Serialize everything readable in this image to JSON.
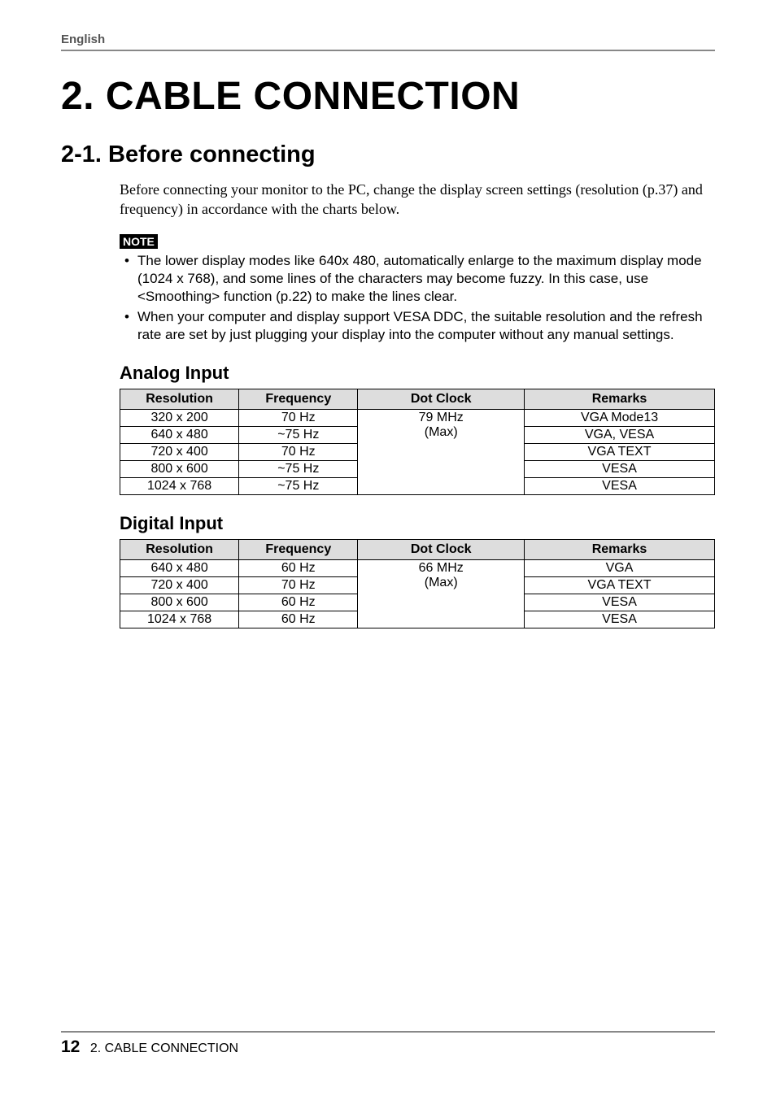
{
  "header": {
    "language": "English"
  },
  "title": "2. CABLE CONNECTION",
  "section": {
    "heading": "2-1. Before connecting",
    "intro": "Before connecting your monitor to the PC, change the display screen settings (resolution (p.37) and frequency) in accordance with the charts below.",
    "note_label": "NOTE",
    "notes": [
      "The lower display modes like 640x 480, automatically enlarge to the maximum display mode (1024 x 768), and some lines of the characters may become fuzzy. In this case, use <Smoothing> function (p.22) to make the lines clear.",
      "When your computer and display support VESA DDC, the suitable resolution and the refresh rate are set by just plugging your display into the computer without any manual settings."
    ]
  },
  "tables": {
    "columns": {
      "resolution": "Resolution",
      "frequency": "Frequency",
      "dot_clock": "Dot Clock",
      "remarks": "Remarks"
    },
    "analog": {
      "title": "Analog Input",
      "dot_clock_line1": "79 MHz",
      "dot_clock_line2": "(Max)",
      "rows": [
        {
          "resolution": "320 x 200",
          "frequency": "70 Hz",
          "remarks": "VGA Mode13"
        },
        {
          "resolution": "640 x 480",
          "frequency": "~75 Hz",
          "remarks": "VGA, VESA"
        },
        {
          "resolution": "720 x 400",
          "frequency": "70 Hz",
          "remarks": "VGA TEXT"
        },
        {
          "resolution": "800 x 600",
          "frequency": "~75 Hz",
          "remarks": "VESA"
        },
        {
          "resolution": "1024 x 768",
          "frequency": "~75 Hz",
          "remarks": "VESA"
        }
      ]
    },
    "digital": {
      "title": "Digital Input",
      "dot_clock_line1": "66 MHz",
      "dot_clock_line2": "(Max)",
      "rows": [
        {
          "resolution": "640 x 480",
          "frequency": "60 Hz",
          "remarks": "VGA"
        },
        {
          "resolution": "720 x 400",
          "frequency": "70 Hz",
          "remarks": "VGA TEXT"
        },
        {
          "resolution": "800 x 600",
          "frequency": "60 Hz",
          "remarks": "VESA"
        },
        {
          "resolution": "1024 x 768",
          "frequency": "60 Hz",
          "remarks": "VESA"
        }
      ]
    }
  },
  "footer": {
    "page_number": "12",
    "section_label": "2. CABLE CONNECTION"
  }
}
